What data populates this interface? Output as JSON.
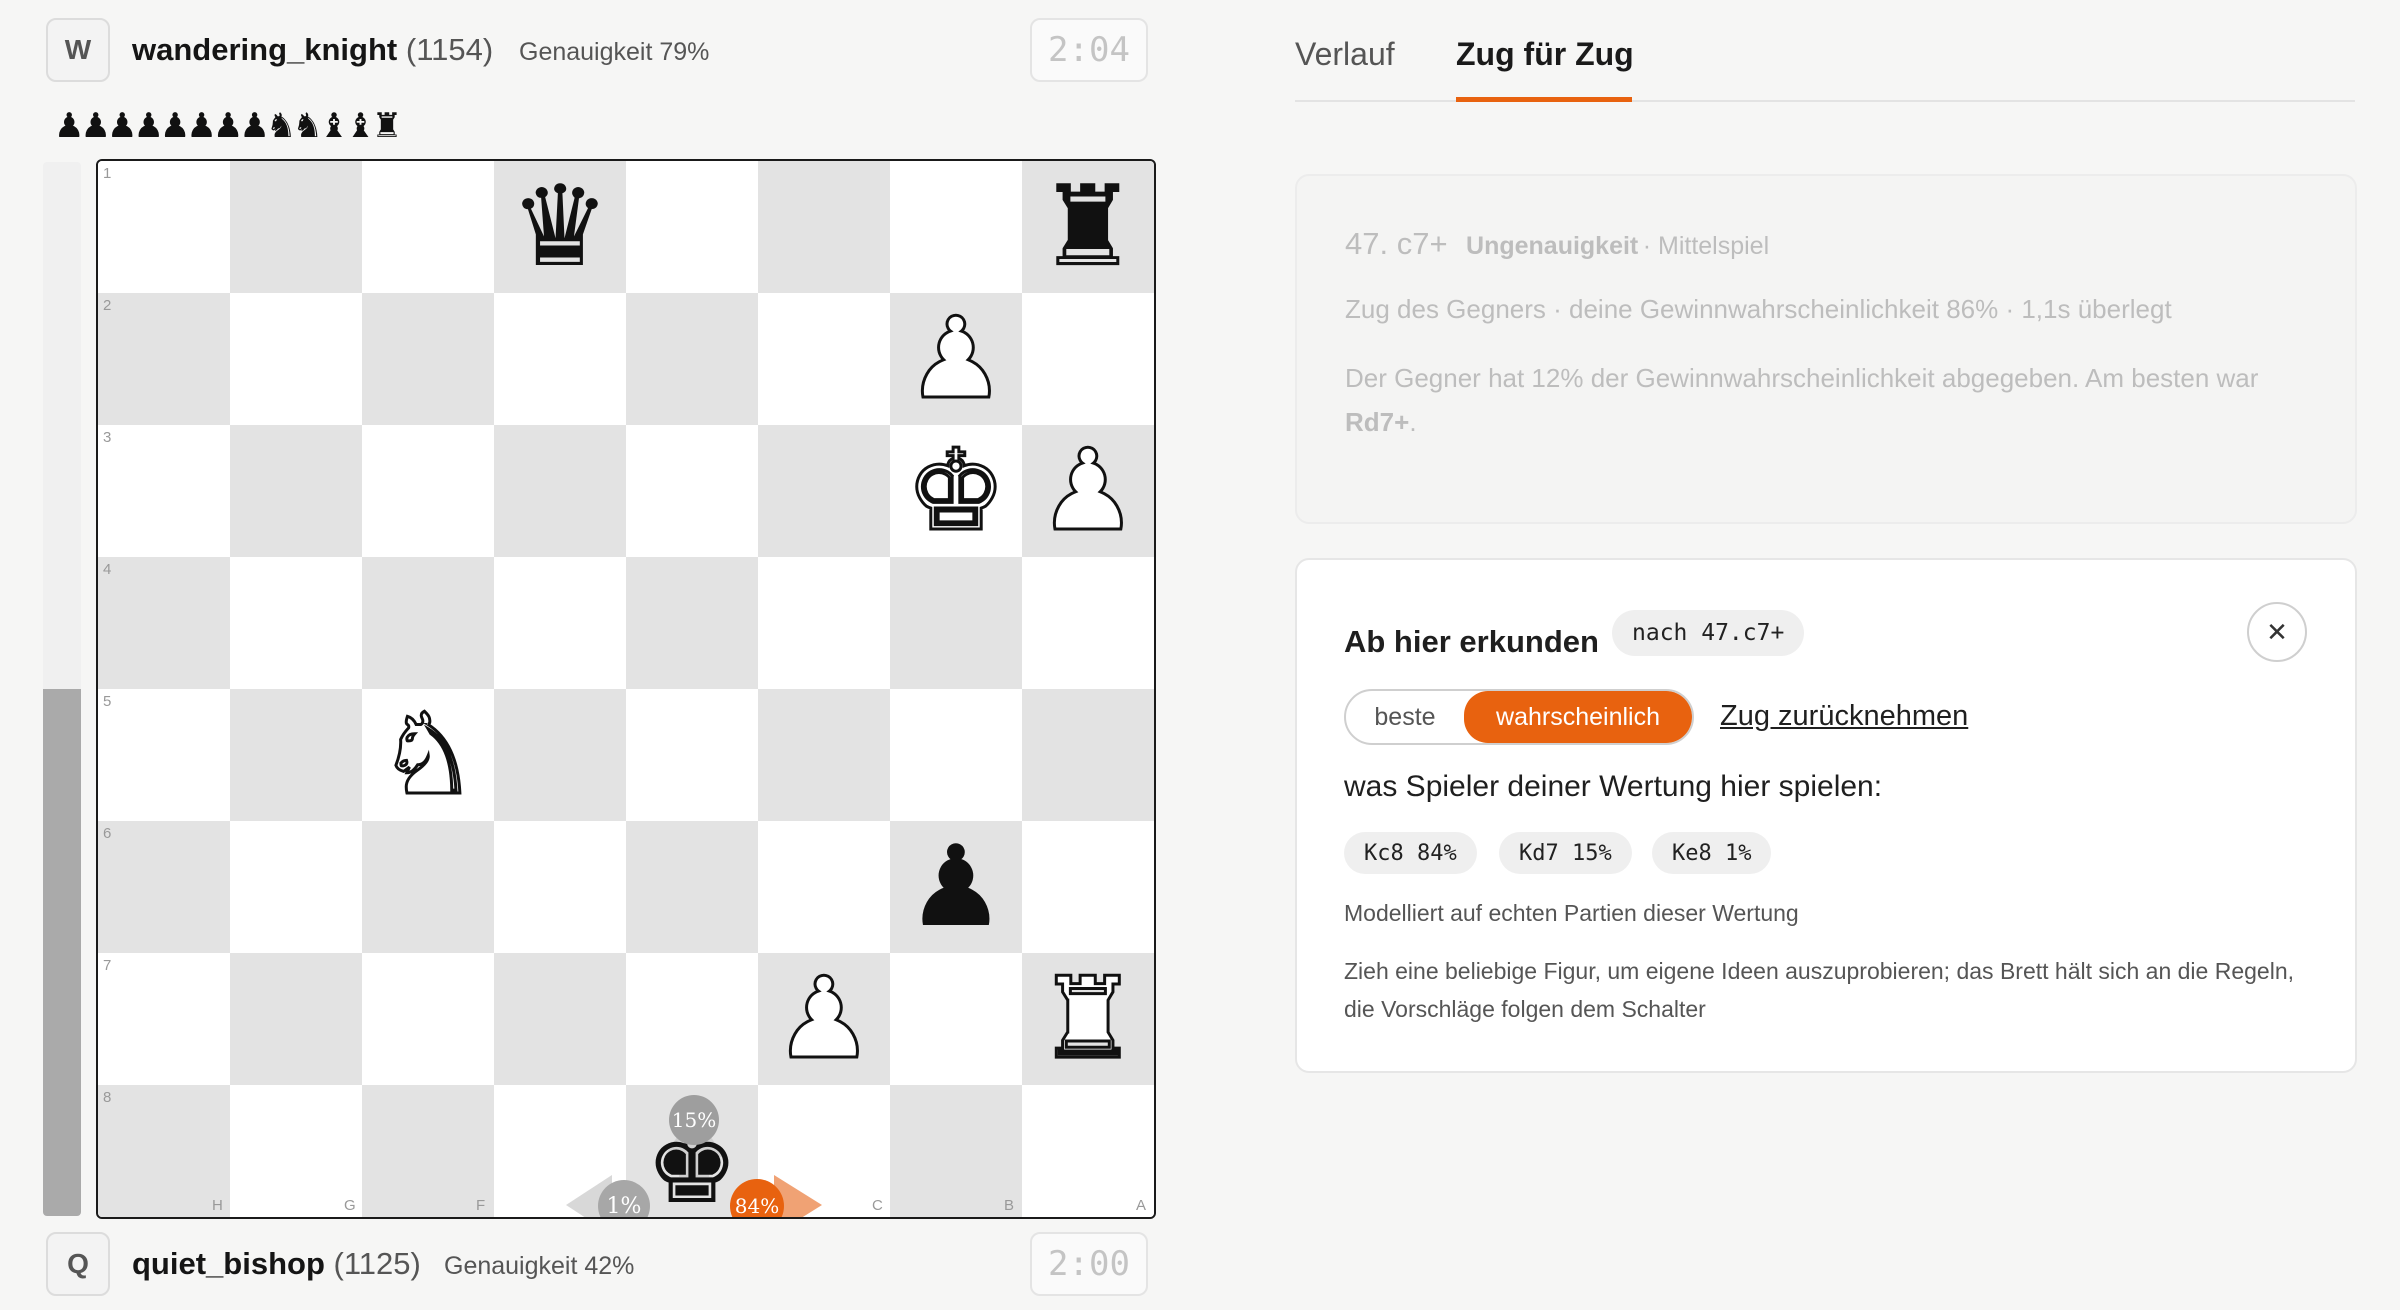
{
  "top_player": {
    "avatar_letter": "W",
    "name": "wandering_knight",
    "rating": "(1154)",
    "accuracy": "Genauigkeit 79%",
    "clock": "2:04",
    "captured": "♟♟♟♟♟♟♟♟♞♞♝♝♜"
  },
  "bottom_player": {
    "avatar_letter": "Q",
    "name": "quiet_bishop",
    "rating": "(1125)",
    "accuracy": "Genauigkeit 42%",
    "clock": "2:00"
  },
  "eval_bar": {
    "white_share": 0.5
  },
  "board": {
    "ranks": [
      "1",
      "2",
      "3",
      "4",
      "5",
      "6",
      "7",
      "8"
    ],
    "files": [
      "H",
      "G",
      "F",
      "E",
      "D",
      "C",
      "B",
      "A"
    ],
    "pieces": [
      {
        "glyph": "♛",
        "color": "black",
        "name": "black-queen"
      },
      {
        "glyph": "♜",
        "color": "black",
        "name": "black-rook"
      },
      {
        "glyph": "♟",
        "color": "white",
        "name": "white-pawn"
      },
      {
        "glyph": "♚",
        "color": "white",
        "name": "white-king"
      },
      {
        "glyph": "♟",
        "color": "white",
        "name": "white-pawn"
      },
      {
        "glyph": "♞",
        "color": "white",
        "name": "white-knight"
      },
      {
        "glyph": "♟",
        "color": "black",
        "name": "black-pawn"
      },
      {
        "glyph": "♟",
        "color": "white",
        "name": "white-pawn"
      },
      {
        "glyph": "♜",
        "color": "white",
        "name": "white-rook"
      },
      {
        "glyph": "♚",
        "color": "black",
        "name": "black-king"
      }
    ],
    "move_hints": [
      {
        "label": "15%",
        "direction": "up"
      },
      {
        "label": "1%",
        "direction": "left"
      },
      {
        "label": "84%",
        "direction": "right"
      }
    ]
  },
  "tabs": [
    {
      "label": "Verlauf",
      "active": false
    },
    {
      "label": "Zug für Zug",
      "active": true
    }
  ],
  "move_card": {
    "move": "47. c7+",
    "classification": "Ungenauigkeit",
    "phase": "· Mittelspiel",
    "info": "Zug des Gegners · deine Gewinnwahrscheinlichkeit 86% · 1,1s überlegt",
    "comment_prefix": "Der Gegner hat 12% der Gewinnwahrscheinlichkeit abgegeben. Am besten war ",
    "best_move": "Rd7+",
    "comment_suffix": "."
  },
  "explore": {
    "title": "Ab hier erkunden",
    "after_tag": "nach 47.c7+",
    "close_symbol": "✕",
    "toggle_best": "beste",
    "toggle_likely": "wahrscheinlich",
    "undo_link": "Zug zurücknehmen",
    "question": "was Spieler deiner Wertung hier spielen:",
    "candidates": [
      "Kc8 84%",
      "Kd7 15%",
      "Ke8 1%"
    ],
    "note": "Modelliert auf echten Partien dieser Wertung",
    "help": "Zieh eine beliebige Figur, um eigene Ideen auszuprobieren; das Brett hält sich an die Regeln, die Vorschläge folgen dem Schalter"
  },
  "colors": {
    "accent": "#e8620f",
    "light_square": "#ffffff",
    "dark_square": "#e3e3e3",
    "eval_fill": "#aaaaaa"
  }
}
